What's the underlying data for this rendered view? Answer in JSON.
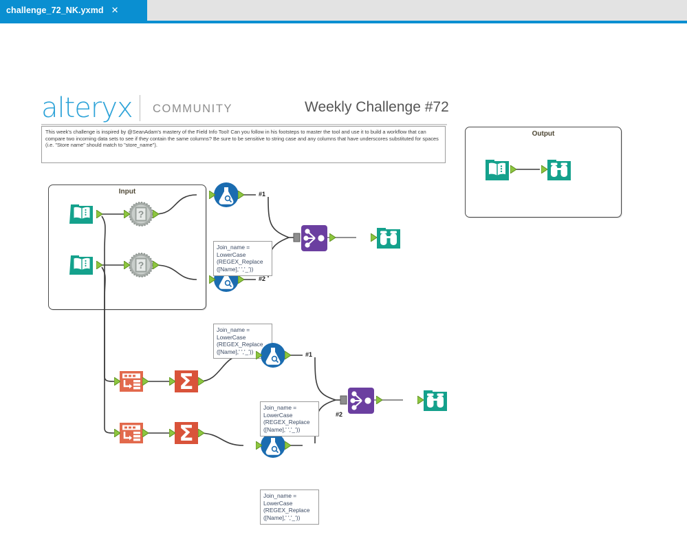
{
  "window": {
    "tab": {
      "title": "challenge_72_NK.yxmd",
      "close_label": "✕"
    }
  },
  "header": {
    "logo_text": "alteryx",
    "logo_sub": "COMMUNITY",
    "title": "Weekly Challenge #72",
    "brand_color": "#2ea3d8"
  },
  "description": {
    "text": "This week's challenge is inspired by @SeanAdam's mastery of the Field Info Tool! Can you follow in his footsteps to master the tool and use it to build a workflow that can compare two incoming data sets to see if they contain the same columns? Be sure to be sensitive to string case and any columns that have underscores substituted for spaces (i.e. \"Store name\" should match to \"store_name\")."
  },
  "containers": [
    {
      "id": "input",
      "label": "Input"
    },
    {
      "id": "output",
      "label": "Output"
    }
  ],
  "annotations": {
    "formula_expression": {
      "line1": "Join_name =",
      "line2": "LowerCase",
      "line3": "(REGEX_Replace",
      "line4": "([Name],' ','_'))"
    }
  },
  "connection_labels": {
    "join1_in1": "#1",
    "join1_in2": "#2",
    "join2_in1": "#1",
    "join2_in2": "#2"
  },
  "tools": [
    {
      "id": "input-1",
      "type": "input-data",
      "name": "Input Data",
      "color": "#14a18c"
    },
    {
      "id": "input-2",
      "type": "input-data",
      "name": "Input Data",
      "color": "#14a18c"
    },
    {
      "id": "fieldinfo-1",
      "type": "field-info",
      "name": "Field Info",
      "color": "#8c938f"
    },
    {
      "id": "fieldinfo-2",
      "type": "field-info",
      "name": "Field Info",
      "color": "#8c938f"
    },
    {
      "id": "formula-1",
      "type": "formula",
      "name": "Formula",
      "color": "#1b6cb0"
    },
    {
      "id": "formula-2",
      "type": "formula",
      "name": "Formula",
      "color": "#1b6cb0"
    },
    {
      "id": "formula-3",
      "type": "formula",
      "name": "Formula",
      "color": "#1b6cb0"
    },
    {
      "id": "formula-4",
      "type": "formula",
      "name": "Formula",
      "color": "#1b6cb0"
    },
    {
      "id": "transpose-1",
      "type": "transpose",
      "name": "Transpose",
      "color": "#e2694c"
    },
    {
      "id": "transpose-2",
      "type": "transpose",
      "name": "Transpose",
      "color": "#e2694c"
    },
    {
      "id": "summarize-1",
      "type": "summarize",
      "name": "Summarize",
      "color": "#d9533a"
    },
    {
      "id": "summarize-2",
      "type": "summarize",
      "name": "Summarize",
      "color": "#d9533a"
    },
    {
      "id": "join-1",
      "type": "join-multiple",
      "name": "Join Multiple",
      "color": "#6b3fa0"
    },
    {
      "id": "join-2",
      "type": "join-multiple",
      "name": "Join Multiple",
      "color": "#6b3fa0"
    },
    {
      "id": "browse-1",
      "type": "browse",
      "name": "Browse",
      "color": "#14a18c"
    },
    {
      "id": "browse-2",
      "type": "browse",
      "name": "Browse",
      "color": "#14a18c"
    },
    {
      "id": "input-3",
      "type": "input-data",
      "name": "Input Data",
      "color": "#14a18c"
    },
    {
      "id": "browse-3",
      "type": "browse",
      "name": "Browse",
      "color": "#14a18c"
    }
  ]
}
